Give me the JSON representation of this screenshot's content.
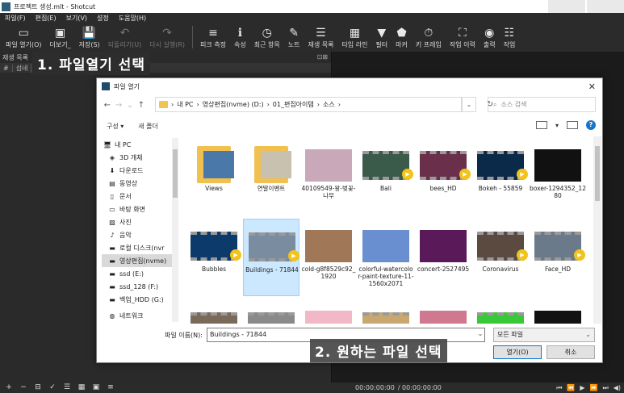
{
  "window": {
    "title": "프로젝트 생성.mlt - Shotcut"
  },
  "menu": [
    "파일(F)",
    "편집(E)",
    "보기(V)",
    "설정",
    "도움말(H)"
  ],
  "toolbar": [
    {
      "label": "파일 열기(O)",
      "icon": "folder-open-icon",
      "glyph": "▭",
      "enabled": true
    },
    {
      "label": "더보기_",
      "icon": "folder-more-icon",
      "glyph": "▣",
      "enabled": true
    },
    {
      "label": "저장(S)",
      "icon": "save-icon",
      "glyph": "💾",
      "enabled": true
    },
    {
      "label": "되돌리기(U)",
      "icon": "undo-icon",
      "glyph": "↶",
      "enabled": false
    },
    {
      "label": "다시 실행(R)",
      "icon": "redo-icon",
      "glyph": "↷",
      "enabled": false
    },
    {
      "label": "피크 측정",
      "icon": "peak-meter-icon",
      "glyph": "≡",
      "enabled": true
    },
    {
      "label": "속성",
      "icon": "properties-icon",
      "glyph": "ℹ",
      "enabled": true
    },
    {
      "label": "최근 항목",
      "icon": "recent-icon",
      "glyph": "◷",
      "enabled": true
    },
    {
      "label": "노트",
      "icon": "notes-icon",
      "glyph": "✎",
      "enabled": true
    },
    {
      "label": "재생 목록",
      "icon": "playlist-icon",
      "glyph": "☰",
      "enabled": true
    },
    {
      "label": "타임 라인",
      "icon": "timeline-icon",
      "glyph": "▦",
      "enabled": true
    },
    {
      "label": "필터",
      "icon": "filter-icon",
      "glyph": "▼",
      "enabled": true
    },
    {
      "label": "마커",
      "icon": "marker-icon",
      "glyph": "⬟",
      "enabled": true
    },
    {
      "label": "키 프레임",
      "icon": "keyframes-icon",
      "glyph": "⏱",
      "enabled": true
    },
    {
      "label": "작업 이력",
      "icon": "history-icon",
      "glyph": "⛶",
      "enabled": true
    },
    {
      "label": "출력",
      "icon": "export-icon",
      "glyph": "◉",
      "enabled": true
    },
    {
      "label": "작업",
      "icon": "jobs-icon",
      "glyph": "☷",
      "enabled": true
    }
  ],
  "left_panel": {
    "title": "재생 목록",
    "tabs": [
      "#",
      "섬네"
    ]
  },
  "callouts": {
    "step1": "1. 파일열기 선택",
    "step2": "2. 원하는 파일 선택"
  },
  "dialog": {
    "title": "파일 열기",
    "breadcrumb": [
      "내 PC",
      "영상편집(nvme) (D:)",
      "01_편집아이템",
      "소스"
    ],
    "search_placeholder": "소스 검색",
    "organize": "구성 ▾",
    "new_folder": "새 폴더",
    "nav": [
      {
        "label": "내 PC",
        "icon": "computer-icon",
        "glyph": "🖥"
      },
      {
        "label": "3D 개체",
        "icon": "3d-objects-icon",
        "glyph": "◈"
      },
      {
        "label": "다운로드",
        "icon": "download-icon",
        "glyph": "⬇"
      },
      {
        "label": "동영상",
        "icon": "video-icon",
        "glyph": "▤"
      },
      {
        "label": "문서",
        "icon": "document-icon",
        "glyph": "▯"
      },
      {
        "label": "바탕 화면",
        "icon": "desktop-icon",
        "glyph": "▭"
      },
      {
        "label": "사진",
        "icon": "pictures-icon",
        "glyph": "▨"
      },
      {
        "label": "음악",
        "icon": "music-icon",
        "glyph": "♪"
      },
      {
        "label": "로컬 디스크(nvr",
        "icon": "drive-icon",
        "glyph": "▬"
      },
      {
        "label": "영상편집(nvme)",
        "icon": "drive-icon",
        "glyph": "▬",
        "selected": true
      },
      {
        "label": "ssd (E:)",
        "icon": "drive-icon",
        "glyph": "▬"
      },
      {
        "label": "ssd_128 (F:)",
        "icon": "drive-icon",
        "glyph": "▬"
      },
      {
        "label": "백업_HDD (G:)",
        "icon": "drive-icon",
        "glyph": "▬"
      },
      {
        "label": "네트워크",
        "icon": "network-icon",
        "glyph": "◍"
      }
    ],
    "files": [
      {
        "label": "Views",
        "kind": "folder",
        "color": "#4a78a8"
      },
      {
        "label": "연말이벤트",
        "kind": "folder",
        "color": "#c9c1b0"
      },
      {
        "label": "40109549-왕-벚꽃-나무",
        "kind": "image",
        "color": "#c9a9b9"
      },
      {
        "label": "Bali",
        "kind": "video",
        "color": "#3a5a4a"
      },
      {
        "label": "bees_HD",
        "kind": "video",
        "color": "#6a2f4a"
      },
      {
        "label": "Bokeh - 55859",
        "kind": "video",
        "color": "#0b2a4a"
      },
      {
        "label": "boxer-1294352_1280",
        "kind": "image",
        "color": "#111111"
      },
      {
        "label": "Bubbles",
        "kind": "video",
        "color": "#0c3a6a"
      },
      {
        "label": "Buildings - 71844",
        "kind": "video",
        "color": "#7a8ca0",
        "selected": true
      },
      {
        "label": "cold-g8f8529c92_1920",
        "kind": "image",
        "color": "#a07858"
      },
      {
        "label": "colorful-watercolor-paint-texture-11-1560x2071",
        "kind": "image",
        "color": "#6a8fd0"
      },
      {
        "label": "concert-2527495",
        "kind": "image",
        "color": "#5a1a5a"
      },
      {
        "label": "Coronavirus",
        "kind": "video",
        "color": "#5a4a40"
      },
      {
        "label": "Face_HD",
        "kind": "video",
        "color": "#6a7a8a"
      },
      {
        "label": "",
        "kind": "video",
        "color": "#7a6a5a"
      },
      {
        "label": "",
        "kind": "video",
        "color": "#8a8a8a"
      },
      {
        "label": "",
        "kind": "image",
        "color": "#f2b8c8"
      },
      {
        "label": "",
        "kind": "video",
        "color": "#c8a870"
      },
      {
        "label": "",
        "kind": "image",
        "color": "#d07890"
      },
      {
        "label": "",
        "kind": "video",
        "color": "#38c838"
      },
      {
        "label": "",
        "kind": "image",
        "color": "#111111"
      }
    ],
    "filename_label": "파일 이름(N):",
    "filename_value": "Buildings - 71844",
    "filter_value": "모든 파일",
    "open_button": "열기(O)",
    "cancel_button": "취소"
  },
  "status": {
    "time_current": "00:00:00:00",
    "time_total": "/ 00:00:00:00"
  }
}
